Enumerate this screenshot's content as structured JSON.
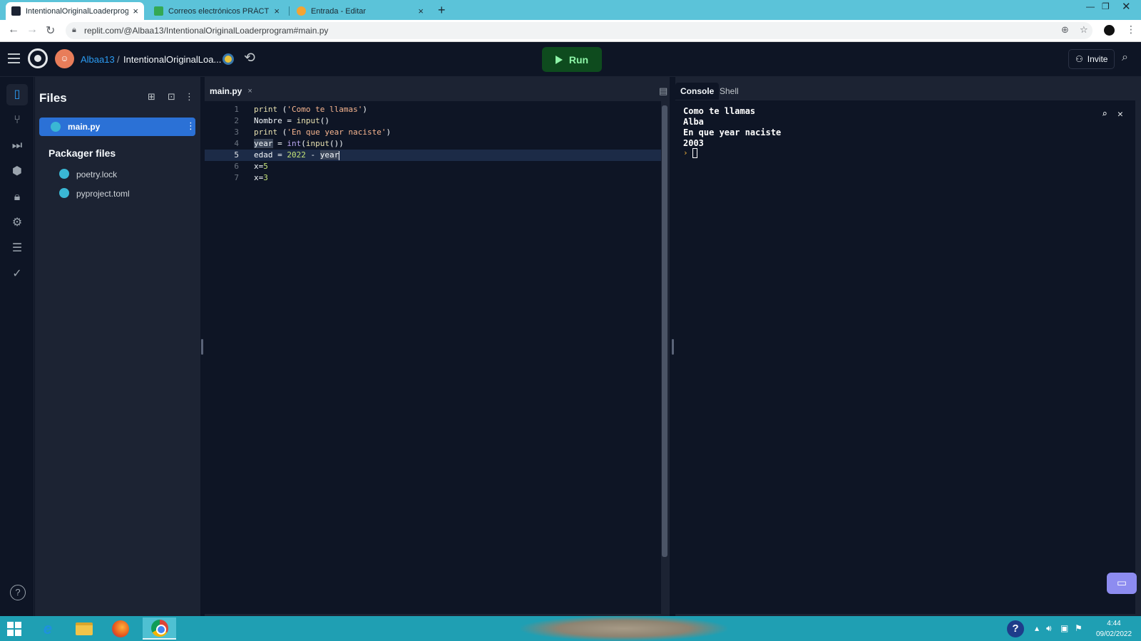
{
  "browser": {
    "tabs": [
      {
        "title": "IntentionalOriginalLoaderprogram",
        "favicon_color": "#1c2333"
      },
      {
        "title": "Correos electrónicos PRÁCTICAS",
        "favicon_color": "#34a853"
      },
      {
        "title": "Entrada - Editar",
        "favicon_color": "#f4a433"
      }
    ],
    "close_glyph": "×",
    "new_tab_glyph": "+",
    "url": "replit.com/@Albaa13/IntentionalOriginalLoaderprogram#main.py"
  },
  "header": {
    "username": "Albaa13",
    "separator": "/",
    "repl_name": "IntentionalOriginalLoa...",
    "run_label": "Run",
    "invite_label": "Invite"
  },
  "files_panel": {
    "title": "Files",
    "active_file": "main.py",
    "packager_title": "Packager files",
    "packager_files": [
      "poetry.lock",
      "pyproject.toml"
    ]
  },
  "editor": {
    "tab_label": "main.py",
    "line_numbers": [
      "1",
      "2",
      "3",
      "4",
      "5",
      "6",
      "7"
    ],
    "lines": [
      {
        "p1": "print",
        "p2": " (",
        "p3": "'Como te llamas'",
        "p4": ")"
      },
      {
        "p1": "Nombre = ",
        "p2": "input",
        "p3": "()"
      },
      {
        "p1": "print",
        "p2": " (",
        "p3": "'En que year naciste'",
        "p4": ")"
      },
      {
        "p1": "year",
        "p2": " = ",
        "p3": "int",
        "p4": "(",
        "p5": "input",
        "p6": "())"
      },
      {
        "p1": "edad = ",
        "p2": "2022",
        "p3": " - ",
        "p4": "year"
      },
      {
        "p1": "x=",
        "p2": "5"
      },
      {
        "p1": "x=",
        "p2": "3"
      }
    ],
    "current_line": 5
  },
  "console": {
    "tabs": [
      "Console",
      "Shell"
    ],
    "output": [
      "Como te llamas",
      "Alba",
      "En que year naciste",
      "2003"
    ],
    "prompt": "›"
  },
  "taskbar": {
    "time": "4:44",
    "date": "09/02/2022"
  }
}
